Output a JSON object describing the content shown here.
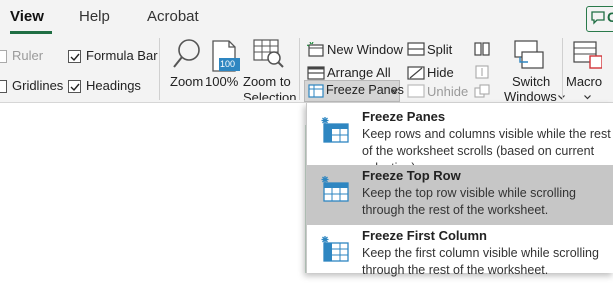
{
  "tabs": [
    {
      "label": "View"
    },
    {
      "label": "Help"
    },
    {
      "label": "Acrobat"
    }
  ],
  "share_button": {
    "label": "C"
  },
  "show_group": {
    "ruler": "Ruler",
    "gridlines": "Gridlines",
    "formula_bar": "Formula Bar",
    "headings": "Headings"
  },
  "zoom_group": {
    "zoom": "Zoom",
    "zoom100": "100%",
    "zoom100_icon_text": "100",
    "zoom_to_selection_line1": "Zoom to",
    "zoom_to_selection_line2": "Selection"
  },
  "window_group": {
    "new_window": "New Window",
    "arrange_all": "Arrange All",
    "freeze_panes": "Freeze Panes",
    "split": "Split",
    "hide": "Hide",
    "unhide": "Unhide",
    "switch_windows_line1": "Switch",
    "switch_windows_line2": "Windows",
    "macros": "Macro"
  },
  "freeze_menu": {
    "items": [
      {
        "title": "Freeze Panes",
        "desc": "Keep rows and columns visible while the rest of the worksheet scrolls (based on current selection).",
        "highlighted": false
      },
      {
        "title": "Freeze Top Row",
        "desc": "Keep the top row visible while scrolling through the rest of the worksheet.",
        "highlighted": true
      },
      {
        "title": "Freeze First Column",
        "desc": "Keep the first column visible while scrolling through the rest of the worksheet.",
        "highlighted": false
      }
    ]
  },
  "colors": {
    "accent": "#1f6e43",
    "icon_blue": "#2e86c1",
    "highlight": "#c6c6c6"
  }
}
